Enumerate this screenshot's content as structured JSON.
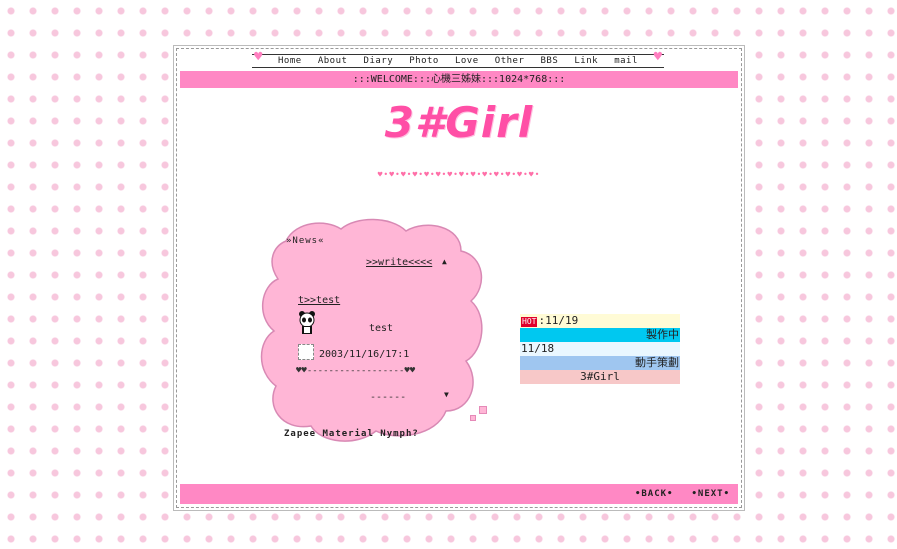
{
  "nav": {
    "items": [
      "Home",
      "About",
      "Diary",
      "Photo",
      "Love",
      "Other",
      "BBS",
      "Link",
      "mail"
    ]
  },
  "welcome": {
    "text": ":::WELCOME:::心機三姊妹:::1024*768:::"
  },
  "logo": {
    "text": "3#Girl"
  },
  "divider": {
    "text": "♥•♥•♥•♥•♥•♥•♥•♥•♥•♥•♥•♥•♥•♥•"
  },
  "news": {
    "title": "»News«",
    "write_link": ">>write<<<<",
    "up_arrow": "▲",
    "post_link": "t>>test",
    "post_body": "test",
    "post_date": "2003/11/16/17:1",
    "separator": "♥♥------------------♥♥",
    "footer_dashes": "------",
    "down_arrow": "▼",
    "credit": "Zapee Material Nymph?"
  },
  "updates": {
    "hot_badge": "HOT",
    "row1_date": ":11/19",
    "row1_text": "製作中",
    "row2_date": "11/18",
    "row2_text": "動手策劃",
    "row3_text": "3#Girl"
  },
  "footer": {
    "back": "•BACK•",
    "next": "•NEXT•"
  },
  "colors": {
    "pink_bar": "#ff88c4",
    "logo_pink": "#ff4fa6",
    "cloud_pink": "#ffb6d6",
    "cyan": "#00c8f0",
    "light_blue": "#9fc6f0",
    "rose": "#f7c8c8"
  }
}
